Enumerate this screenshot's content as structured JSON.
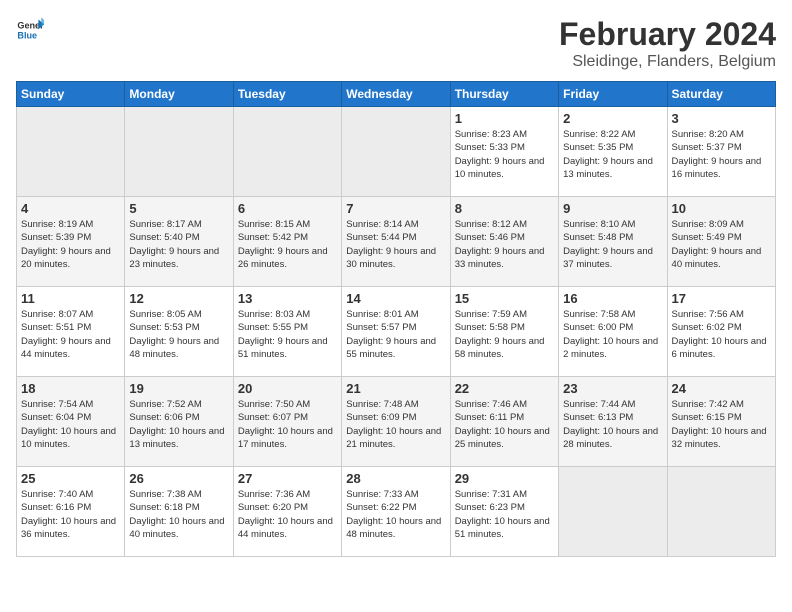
{
  "header": {
    "logo_text_general": "General",
    "logo_text_blue": "Blue",
    "month_title": "February 2024",
    "subtitle": "Sleidinge, Flanders, Belgium"
  },
  "weekdays": [
    "Sunday",
    "Monday",
    "Tuesday",
    "Wednesday",
    "Thursday",
    "Friday",
    "Saturday"
  ],
  "weeks": [
    [
      {
        "day": "",
        "empty": true
      },
      {
        "day": "",
        "empty": true
      },
      {
        "day": "",
        "empty": true
      },
      {
        "day": "",
        "empty": true
      },
      {
        "day": "1",
        "sunrise": "8:23 AM",
        "sunset": "5:33 PM",
        "daylight": "9 hours and 10 minutes."
      },
      {
        "day": "2",
        "sunrise": "8:22 AM",
        "sunset": "5:35 PM",
        "daylight": "9 hours and 13 minutes."
      },
      {
        "day": "3",
        "sunrise": "8:20 AM",
        "sunset": "5:37 PM",
        "daylight": "9 hours and 16 minutes."
      }
    ],
    [
      {
        "day": "4",
        "sunrise": "8:19 AM",
        "sunset": "5:39 PM",
        "daylight": "9 hours and 20 minutes."
      },
      {
        "day": "5",
        "sunrise": "8:17 AM",
        "sunset": "5:40 PM",
        "daylight": "9 hours and 23 minutes."
      },
      {
        "day": "6",
        "sunrise": "8:15 AM",
        "sunset": "5:42 PM",
        "daylight": "9 hours and 26 minutes."
      },
      {
        "day": "7",
        "sunrise": "8:14 AM",
        "sunset": "5:44 PM",
        "daylight": "9 hours and 30 minutes."
      },
      {
        "day": "8",
        "sunrise": "8:12 AM",
        "sunset": "5:46 PM",
        "daylight": "9 hours and 33 minutes."
      },
      {
        "day": "9",
        "sunrise": "8:10 AM",
        "sunset": "5:48 PM",
        "daylight": "9 hours and 37 minutes."
      },
      {
        "day": "10",
        "sunrise": "8:09 AM",
        "sunset": "5:49 PM",
        "daylight": "9 hours and 40 minutes."
      }
    ],
    [
      {
        "day": "11",
        "sunrise": "8:07 AM",
        "sunset": "5:51 PM",
        "daylight": "9 hours and 44 minutes."
      },
      {
        "day": "12",
        "sunrise": "8:05 AM",
        "sunset": "5:53 PM",
        "daylight": "9 hours and 48 minutes."
      },
      {
        "day": "13",
        "sunrise": "8:03 AM",
        "sunset": "5:55 PM",
        "daylight": "9 hours and 51 minutes."
      },
      {
        "day": "14",
        "sunrise": "8:01 AM",
        "sunset": "5:57 PM",
        "daylight": "9 hours and 55 minutes."
      },
      {
        "day": "15",
        "sunrise": "7:59 AM",
        "sunset": "5:58 PM",
        "daylight": "9 hours and 58 minutes."
      },
      {
        "day": "16",
        "sunrise": "7:58 AM",
        "sunset": "6:00 PM",
        "daylight": "10 hours and 2 minutes."
      },
      {
        "day": "17",
        "sunrise": "7:56 AM",
        "sunset": "6:02 PM",
        "daylight": "10 hours and 6 minutes."
      }
    ],
    [
      {
        "day": "18",
        "sunrise": "7:54 AM",
        "sunset": "6:04 PM",
        "daylight": "10 hours and 10 minutes."
      },
      {
        "day": "19",
        "sunrise": "7:52 AM",
        "sunset": "6:06 PM",
        "daylight": "10 hours and 13 minutes."
      },
      {
        "day": "20",
        "sunrise": "7:50 AM",
        "sunset": "6:07 PM",
        "daylight": "10 hours and 17 minutes."
      },
      {
        "day": "21",
        "sunrise": "7:48 AM",
        "sunset": "6:09 PM",
        "daylight": "10 hours and 21 minutes."
      },
      {
        "day": "22",
        "sunrise": "7:46 AM",
        "sunset": "6:11 PM",
        "daylight": "10 hours and 25 minutes."
      },
      {
        "day": "23",
        "sunrise": "7:44 AM",
        "sunset": "6:13 PM",
        "daylight": "10 hours and 28 minutes."
      },
      {
        "day": "24",
        "sunrise": "7:42 AM",
        "sunset": "6:15 PM",
        "daylight": "10 hours and 32 minutes."
      }
    ],
    [
      {
        "day": "25",
        "sunrise": "7:40 AM",
        "sunset": "6:16 PM",
        "daylight": "10 hours and 36 minutes."
      },
      {
        "day": "26",
        "sunrise": "7:38 AM",
        "sunset": "6:18 PM",
        "daylight": "10 hours and 40 minutes."
      },
      {
        "day": "27",
        "sunrise": "7:36 AM",
        "sunset": "6:20 PM",
        "daylight": "10 hours and 44 minutes."
      },
      {
        "day": "28",
        "sunrise": "7:33 AM",
        "sunset": "6:22 PM",
        "daylight": "10 hours and 48 minutes."
      },
      {
        "day": "29",
        "sunrise": "7:31 AM",
        "sunset": "6:23 PM",
        "daylight": "10 hours and 51 minutes."
      },
      {
        "day": "",
        "empty": true
      },
      {
        "day": "",
        "empty": true
      }
    ]
  ]
}
